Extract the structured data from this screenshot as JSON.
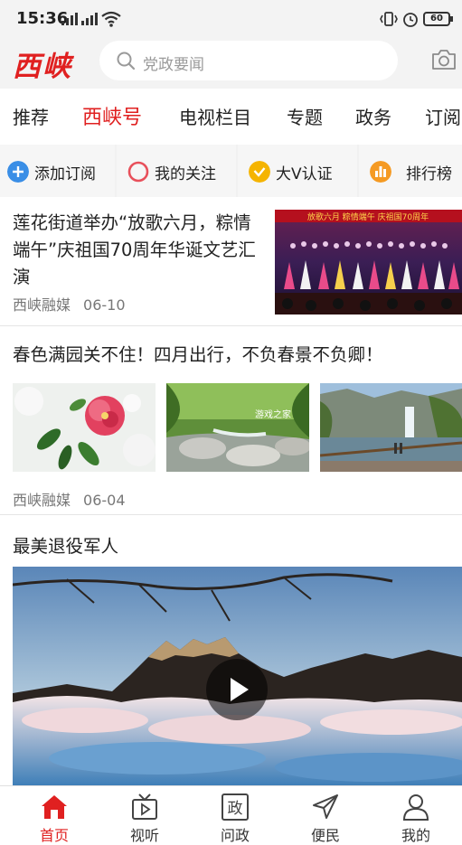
{
  "status_bar": {
    "time": "15:36",
    "battery": "60"
  },
  "header": {
    "logo": "西峡",
    "search_placeholder": "党政要闻"
  },
  "tabs": [
    {
      "label": "推荐",
      "active": false
    },
    {
      "label": "西峡号",
      "active": true
    },
    {
      "label": "电视栏目",
      "active": false
    },
    {
      "label": "专题",
      "active": false
    },
    {
      "label": "政务",
      "active": false
    },
    {
      "label": "订阅",
      "active": false
    }
  ],
  "quick_actions": [
    {
      "label": "添加订阅",
      "icon": "plus-circle-icon",
      "color": "#3a8ee6"
    },
    {
      "label": "我的关注",
      "icon": "ring-icon",
      "color": "#e8505b"
    },
    {
      "label": "大V认证",
      "icon": "check-badge-icon",
      "color": "#f5b400"
    },
    {
      "label": "排行榜",
      "icon": "ranking-icon",
      "color": "#f59a23"
    }
  ],
  "articles": [
    {
      "title": "莲花街道举办“放歌六月，粽情端午”庆祖国70周年华诞文艺汇演",
      "source": "西峡融媒",
      "date": "06-10",
      "image_banner": "放歌六月 粽情端午 庆祖国70周年"
    },
    {
      "title": "春色满园关不住！四月出行，不负春景不负卿！",
      "source": "西峡融媒",
      "date": "06-04",
      "watermark": "游戏之家"
    },
    {
      "title": "最美退役军人"
    }
  ],
  "bottom_nav": [
    {
      "label": "首页",
      "icon": "home-icon",
      "active": true
    },
    {
      "label": "视听",
      "icon": "tv-icon",
      "active": false
    },
    {
      "label": "问政",
      "icon": "zheng-icon",
      "icon_text": "政",
      "active": false
    },
    {
      "label": "便民",
      "icon": "send-icon",
      "active": false
    },
    {
      "label": "我的",
      "icon": "person-icon",
      "active": false
    }
  ],
  "colors": {
    "brand": "#e02020",
    "text": "#222222",
    "meta": "#777777"
  }
}
